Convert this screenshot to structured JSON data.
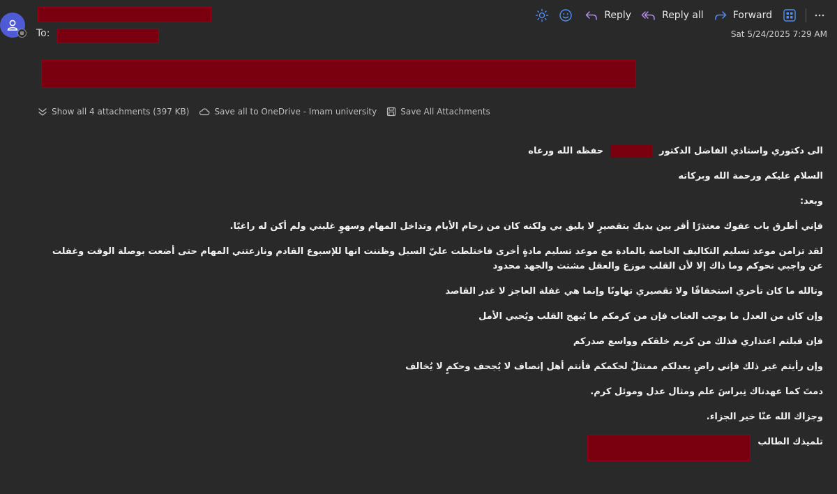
{
  "header": {
    "to_label": "To:",
    "date": "Sat 5/24/2025 7:29 AM"
  },
  "toolbar": {
    "reply": "Reply",
    "reply_all": "Reply all",
    "forward": "Forward"
  },
  "attachments": {
    "show_all": "Show all 4 attachments (397 KB)",
    "save_onedrive": "Save all to OneDrive - Imam university",
    "save_all": "Save All Attachments"
  },
  "body": {
    "greeting_part1": "الى دكتوري واستاذي الفاضل الدكتور",
    "greeting_part2": "حفظه الله ورعاه",
    "salam": "السلام عليكم ورحمة الله وبركاته",
    "opening": "وبعد:",
    "p1": "فإني أطرق باب عفوك معتذرًا أقر بين يديك بتقصيرٍ لا يليق بي ولكنه كان من زحام الأيام وتداخل المهام وسهوٍ غلبني ولم أكن له راغبًا.",
    "p2": "لقد تزامن موعد تسليم التكاليف الخاصة بالمادة مع موعد تسليم مادةٍ أخرى فاختلطت عليّ السبل وظننت انها للإسبوع القادم ونازعتني المهام حتى أضعت بوصلة الوقت وغفلت عن واجبي نحوكم وما ذاك إلا لأن القلب موزع والعقل مشتت والجهد محدود",
    "p3": "وتالله ما كان تأخري استخفافًا ولا تقصيري تهاونًا وإنما هي غفلة العاجز لا غدر القاصد",
    "p4": "وإن كان من العدل ما يوجب العتاب فإن من كرمكم ما يُبهج القلب ويُحيي الأمل",
    "p5": "فإن قبلتم اعتذاري فذلك من كريم خلقكم وواسع صدركم",
    "p6": "وإن رأيتم غير ذلك فإني راضٍ بعدلكم ممتثلٌ لحكمكم فأنتم أهل إنصاف لا يُجحف وحكمٍ لا يُخالف",
    "p7": "دمتَ كما عهدناك نِبراسَ علم ومثال عدل وموئل كرم.",
    "p8": "وجزاك الله عنّا خير الجزاء.",
    "signature": "تلميذك الطالب"
  },
  "colors": {
    "background": "#292929",
    "redaction": "#7a0010",
    "accent": "#4f8ef7",
    "reply_all_purple": "#b18cf0"
  },
  "icons": [
    "avatar-icon",
    "sun-icon",
    "smiley-icon",
    "reply-icon",
    "reply-all-icon",
    "forward-icon",
    "apps-icon",
    "more-icon",
    "chevrons-icon",
    "cloud-icon",
    "save-icon"
  ]
}
